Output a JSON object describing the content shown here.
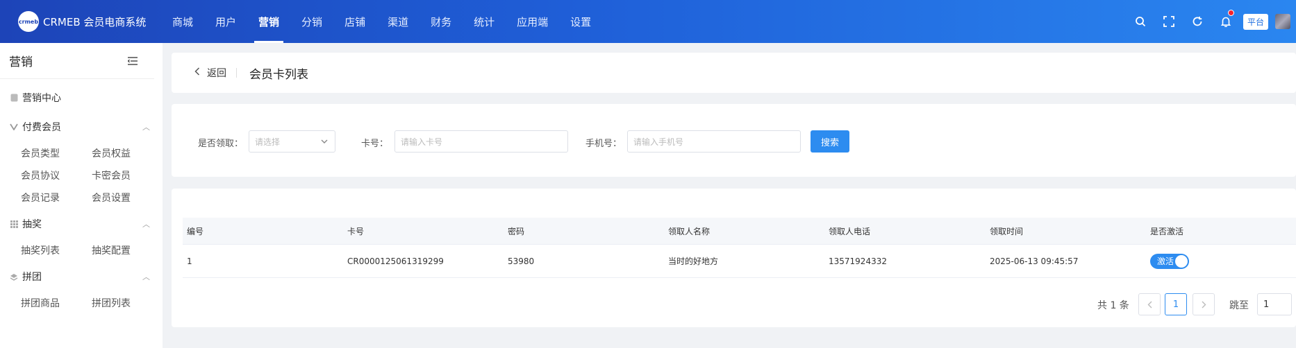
{
  "brand": {
    "logo_mark": "crmeb",
    "name": "CRMEB 会员电商系统"
  },
  "nav": [
    "商城",
    "用户",
    "营销",
    "分销",
    "店铺",
    "渠道",
    "财务",
    "统计",
    "应用端",
    "设置"
  ],
  "nav_active": "营销",
  "header_right": {
    "platform_badge": "平台",
    "icons": [
      "search-icon",
      "fullscreen-icon",
      "refresh-icon",
      "bell-icon"
    ]
  },
  "sidebar": {
    "title": "营销",
    "center": "营销中心",
    "groups": [
      {
        "label": "付费会员",
        "items": [
          "会员类型",
          "会员权益",
          "会员协议",
          "卡密会员",
          "会员记录",
          "会员设置"
        ]
      },
      {
        "label": "抽奖",
        "items": [
          "抽奖列表",
          "抽奖配置"
        ]
      },
      {
        "label": "拼团",
        "items": [
          "拼团商品",
          "拼团列表"
        ]
      }
    ]
  },
  "page": {
    "back_label": "返回",
    "title": "会员卡列表"
  },
  "filter": {
    "received_label": "是否领取：",
    "received_placeholder": "请选择",
    "card_label": "卡号：",
    "card_placeholder": "请输入卡号",
    "phone_label": "手机号：",
    "phone_placeholder": "请输入手机号",
    "search_button": "搜索"
  },
  "table": {
    "columns": [
      "编号",
      "卡号",
      "密码",
      "领取人名称",
      "领取人电话",
      "领取时间",
      "是否激活"
    ],
    "rows": [
      {
        "id": "1",
        "card_no": "CR0000125061319299",
        "password": "53980",
        "receiver_name": "当时的好地方",
        "receiver_phone": "13571924332",
        "received_at": "2025-06-13 09:45:57",
        "active_label": "激活"
      }
    ]
  },
  "pagination": {
    "total_text": "共 1 条",
    "current_page": "1",
    "jump_label": "跳至",
    "jump_value": "1"
  },
  "colors": {
    "accent": "#2d8cf0",
    "topbar_start": "#1d44b8",
    "topbar_end": "#2a86f0"
  }
}
